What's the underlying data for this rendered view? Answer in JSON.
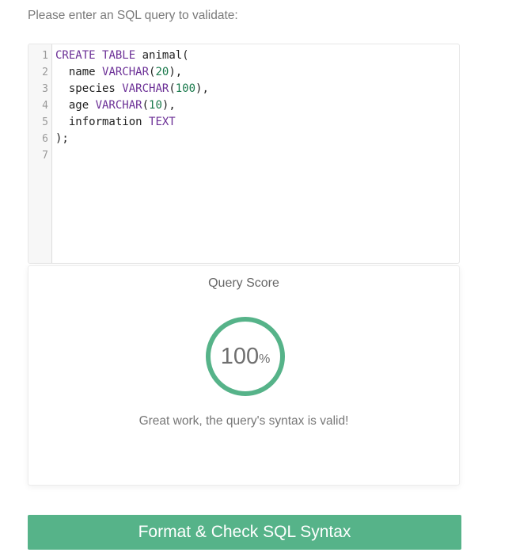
{
  "prompt": "Please enter an SQL query to validate:",
  "editor": {
    "line_numbers": [
      "1",
      "2",
      "3",
      "4",
      "5",
      "6",
      "7"
    ],
    "lines": [
      [
        {
          "t": "CREATE",
          "c": "kw"
        },
        {
          "t": " "
        },
        {
          "t": "TABLE",
          "c": "kw"
        },
        {
          "t": " animal("
        }
      ],
      [
        {
          "t": "  name "
        },
        {
          "t": "VARCHAR",
          "c": "kw"
        },
        {
          "t": "("
        },
        {
          "t": "20",
          "c": "num"
        },
        {
          "t": "),"
        }
      ],
      [
        {
          "t": "  species "
        },
        {
          "t": "VARCHAR",
          "c": "kw"
        },
        {
          "t": "("
        },
        {
          "t": "100",
          "c": "num"
        },
        {
          "t": "),"
        }
      ],
      [
        {
          "t": "  age "
        },
        {
          "t": "VARCHAR",
          "c": "kw"
        },
        {
          "t": "("
        },
        {
          "t": "10",
          "c": "num"
        },
        {
          "t": "),"
        }
      ],
      [
        {
          "t": "  information "
        },
        {
          "t": "TEXT",
          "c": "kw"
        }
      ],
      [
        {
          "t": ");"
        }
      ],
      []
    ]
  },
  "score": {
    "title": "Query Score",
    "value": "100",
    "unit": "%",
    "percent": 100,
    "message": "Great work, the query's syntax is valid!",
    "ring_color": "#56b389"
  },
  "submit_label": "Format & Check SQL Syntax",
  "colors": {
    "accent": "#56b389",
    "keyword": "#6b2f96",
    "number": "#1a7a4c"
  }
}
